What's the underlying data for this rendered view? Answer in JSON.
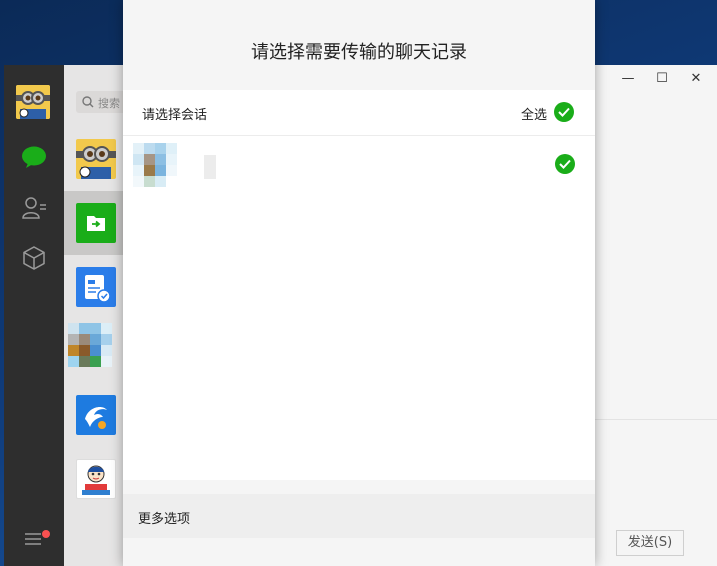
{
  "dialog": {
    "title": "请选择需要传输的聊天记录",
    "select_prompt": "请选择会话",
    "select_all_label": "全选",
    "more_options": "更多选项"
  },
  "main_window": {
    "search_placeholder": "搜索",
    "send_label": "发送(S)",
    "controls": {
      "minimize": "—",
      "maximize": "☐",
      "close": "✕"
    }
  },
  "colors": {
    "accent_green": "#1aad19",
    "nav_bg": "#2e2e2e",
    "notification_red": "#fa5151"
  }
}
